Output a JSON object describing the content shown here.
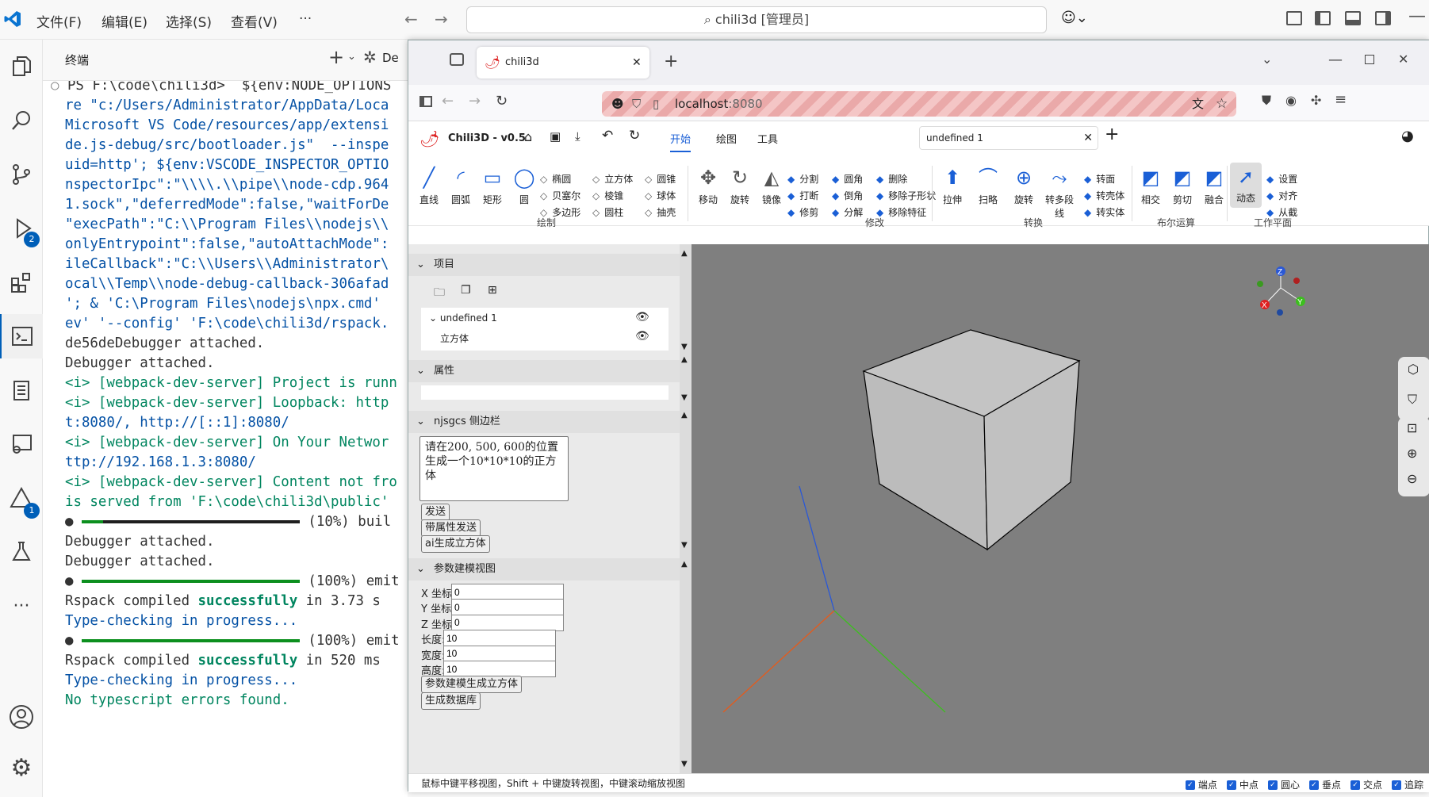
{
  "vscode": {
    "menu": [
      "文件(F)",
      "编辑(E)",
      "选择(S)",
      "查看(V)",
      "···"
    ],
    "search": "chili3d [管理员]",
    "terminal_title": "终端",
    "terminal_action_label": "De",
    "badges": {
      "debug": "2",
      "warnings": "1"
    }
  },
  "terminal": {
    "lines": [
      {
        "t": "PS F:\\code\\chili3d>  ${env:NODE_OPTIONS",
        "c": "",
        "prompt": true
      },
      {
        "t": "re \"c:/Users/Administrator/AppData/Loca",
        "c": "c-b"
      },
      {
        "t": "Microsoft VS Code/resources/app/extensi",
        "c": "c-b"
      },
      {
        "t": "de.js-debug/src/bootloader.js\"  --inspe",
        "c": "c-b"
      },
      {
        "t": "uid=http'; ${env:VSCODE_INSPECTOR_OPTIO",
        "c": "c-b"
      },
      {
        "t": "nspectorIpc\":\"\\\\\\\\.\\\\pipe\\\\node-cdp.964",
        "c": "c-b"
      },
      {
        "t": "1.sock\",\"deferredMode\":false,\"waitForDe",
        "c": "c-b"
      },
      {
        "t": "\"execPath\":\"C:\\\\Program Files\\\\nodejs\\\\",
        "c": "c-b"
      },
      {
        "t": "onlyEntrypoint\":false,\"autoAttachMode\":",
        "c": "c-b"
      },
      {
        "t": "ileCallback\":\"C:\\\\Users\\\\Administrator\\",
        "c": "c-b"
      },
      {
        "t": "ocal\\\\Temp\\\\node-debug-callback-306afad",
        "c": "c-b"
      },
      {
        "t": "'; & 'C:\\Program Files\\nodejs\\npx.cmd'",
        "c": "c-b"
      },
      {
        "t": "ev' '--config' 'F:\\code\\chili3d/rspack.",
        "c": "c-b"
      },
      {
        "t": "",
        "c": ""
      },
      {
        "t": "de56deDebugger attached.",
        "c": ""
      },
      {
        "t": "Debugger attached.",
        "c": ""
      },
      {
        "t": "<i> [webpack-dev-server] Project is runn",
        "c": "c-g"
      },
      {
        "t": "<i> [webpack-dev-server] Loopback: http",
        "c": "c-g"
      },
      {
        "t": "t:8080/, http://[::1]:8080/",
        "c": "c-b"
      },
      {
        "t": "<i> [webpack-dev-server] On Your Networ",
        "c": "c-g"
      },
      {
        "t": "ttp://192.168.1.3:8080/",
        "c": "c-b"
      },
      {
        "t": "<i> [webpack-dev-server] Content not fro",
        "c": "c-g"
      },
      {
        "t": "is served from 'F:\\code\\chili3d\\public'",
        "c": "c-g"
      },
      {
        "t": "",
        "bar": 0.1,
        "tail": " (10%) buil"
      },
      {
        "t": "Debugger attached.",
        "c": ""
      },
      {
        "t": "Debugger attached.",
        "c": ""
      },
      {
        "t": "",
        "bar": 1.0,
        "tail": " (100%) emit"
      },
      {
        "t": "Rspack compiled ",
        "c": "",
        "succ": "successfully",
        "rest": " in 3.73 s"
      },
      {
        "t": "Type-checking in progress...",
        "c": "c-b"
      },
      {
        "t": "",
        "bar": 1.0,
        "tail": " (100%) emit"
      },
      {
        "t": "Rspack compiled ",
        "c": "",
        "succ": "successfully",
        "rest": " in 520 ms"
      },
      {
        "t": "Type-checking in progress...",
        "c": "c-b"
      },
      {
        "t": "No typescript errors found.",
        "c": "c-g"
      }
    ]
  },
  "browser": {
    "tab_title": "chili3d",
    "url_host": "localhost",
    "url_port": ":8080"
  },
  "app": {
    "name": "Chili3D - v0.5",
    "tabs": [
      "开始",
      "绘图",
      "工具"
    ],
    "doc_tab": "undefined 1"
  },
  "ribbon": {
    "draw_big": [
      "直线",
      "圆弧",
      "矩形",
      "圆"
    ],
    "draw_small": [
      [
        "椭圆",
        "立方体",
        "圆锥"
      ],
      [
        "贝塞尔",
        "棱锥",
        "球体"
      ],
      [
        "多边形",
        "圆柱",
        "抽壳"
      ]
    ],
    "draw_group": "绘制",
    "modify_big": [
      "移动",
      "旋转",
      "镜像"
    ],
    "modify_small": [
      [
        "分割",
        "圆角",
        "删除"
      ],
      [
        "打断",
        "倒角",
        "移除子形状"
      ],
      [
        "修剪",
        "分解",
        "移除特征"
      ]
    ],
    "modify_group": "修改",
    "convert_big": [
      "拉伸",
      "扫略",
      "旋转",
      "转多段线"
    ],
    "convert_small": [
      "转面",
      "转壳体",
      "转实体"
    ],
    "convert_group": "转换",
    "bool_big": [
      "相交",
      "剪切",
      "融合"
    ],
    "bool_group": "布尔运算",
    "wp_big": "动态",
    "wp_small": [
      "设置",
      "对齐",
      "从截"
    ],
    "wp_group": "工作平面"
  },
  "sidebar": {
    "project_title": "项目",
    "doc_name": "undefined 1",
    "item_name": "立方体",
    "props_title": "属性",
    "njsgcs_title": "njsgcs 侧边栏",
    "prompt_text": "请在200, 500, 600的位置生成一个10*10*10的正方体",
    "buttons": [
      "发送",
      "带属性发送",
      "ai生成立方体"
    ],
    "param_title": "参数建模视图",
    "fields": [
      {
        "label": "X 坐标:",
        "value": "0"
      },
      {
        "label": "Y 坐标:",
        "value": "0"
      },
      {
        "label": "Z 坐标:",
        "value": "0"
      },
      {
        "label": "长度:",
        "value": "10"
      },
      {
        "label": "宽度:",
        "value": "10"
      },
      {
        "label": "高度:",
        "value": "10"
      }
    ],
    "param_buttons": [
      "参数建模生成立方体",
      "生成数据库"
    ]
  },
  "status": {
    "hint": "鼠标中键平移视图，Shift + 中键旋转视图，中键滚动缩放视图",
    "snaps": [
      "端点",
      "中点",
      "圆心",
      "垂点",
      "交点",
      "追踪"
    ]
  },
  "colors": {
    "accent": "#005fb8",
    "viewport": "#7f7f7f",
    "url_warning": "#f4c6c6",
    "ai_blue": "#1a5fd6"
  }
}
